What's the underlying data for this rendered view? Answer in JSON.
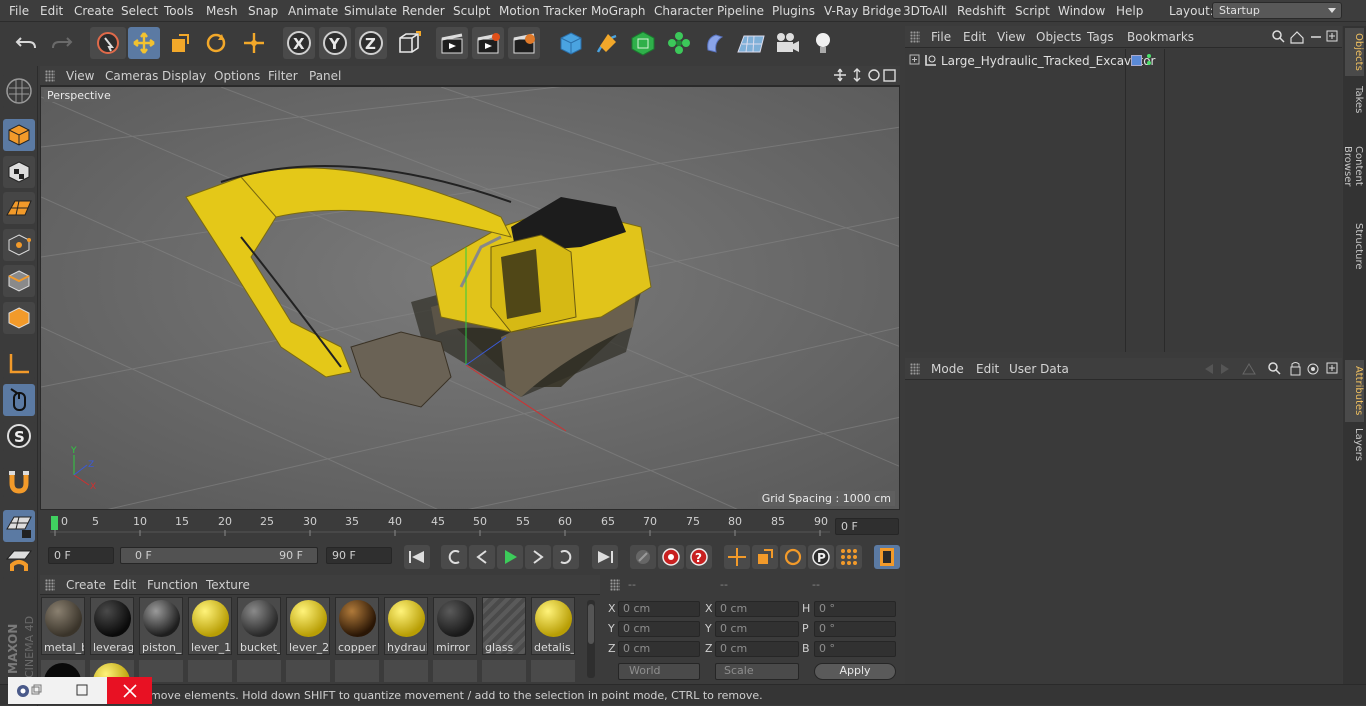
{
  "menu": [
    "File",
    "Edit",
    "Create",
    "Select",
    "Tools",
    "Mesh",
    "Snap",
    "Animate",
    "Simulate",
    "Render",
    "Sculpt",
    "Motion Tracker",
    "MoGraph",
    "Character",
    "Pipeline",
    "Plugins",
    "V-Ray Bridge",
    "3DToAll",
    "Redshift",
    "Script",
    "Window",
    "Help"
  ],
  "layout": {
    "label": "Layout:",
    "value": "Startup"
  },
  "viewport": {
    "menu": [
      "View",
      "Cameras",
      "Display",
      "Options",
      "Filter",
      "Panel"
    ],
    "label": "Perspective",
    "grid_spacing": "Grid Spacing : 1000 cm"
  },
  "timeline": {
    "ticks": [
      "0",
      "5",
      "10",
      "15",
      "20",
      "25",
      "30",
      "35",
      "40",
      "45",
      "50",
      "55",
      "60",
      "65",
      "70",
      "75",
      "80",
      "85",
      "90"
    ],
    "current_frame": "0 F"
  },
  "anim": {
    "start": "0 F",
    "range_start": "0 F",
    "range_end": "90 F",
    "end": "90 F"
  },
  "materials": {
    "menu": [
      "Create",
      "Edit",
      "Function",
      "Texture"
    ],
    "items": [
      {
        "name": "metal_b",
        "color": "#5a5248"
      },
      {
        "name": "leverage",
        "color": "#1a1a1a"
      },
      {
        "name": "piston_r",
        "color": "#3a3a3a"
      },
      {
        "name": "lever_1",
        "color": "#e0c81a"
      },
      {
        "name": "bucket_",
        "color": "#4a4a4a"
      },
      {
        "name": "lever_2",
        "color": "#e0c81a"
      },
      {
        "name": "copper",
        "color": "#5a3410"
      },
      {
        "name": "hydrauli",
        "color": "#e0c81a"
      },
      {
        "name": "mirror",
        "color": "#2a2a2a"
      },
      {
        "name": "glass",
        "color": "#6a6a6a"
      },
      {
        "name": "detalis_",
        "color": "#e0c81a"
      }
    ]
  },
  "coords": {
    "headers": [
      "--",
      "--",
      "--"
    ],
    "rows": [
      {
        "label": "X",
        "value": "0 cm",
        "label2": "X",
        "value2": "0 cm",
        "label3": "H",
        "value3": "0 °"
      },
      {
        "label": "Y",
        "value": "0 cm",
        "label2": "Y",
        "value2": "0 cm",
        "label3": "P",
        "value3": "0 °"
      },
      {
        "label": "Z",
        "value": "0 cm",
        "label2": "Z",
        "value2": "0 cm",
        "label3": "B",
        "value3": "0 °"
      }
    ],
    "world": "World",
    "scale": "Scale",
    "apply": "Apply"
  },
  "objects": {
    "menu": [
      "File",
      "Edit",
      "View",
      "Objects",
      "Tags",
      "Bookmarks"
    ],
    "items": [
      {
        "name": "Large_Hydraulic_Tracked_Excavator"
      }
    ]
  },
  "attributes": {
    "menu": [
      "Mode",
      "Edit",
      "User Data"
    ]
  },
  "right_tabs": [
    "Objects",
    "Takes",
    "Content Browser",
    "Structure"
  ],
  "right_tabs2": [
    "Attributes",
    "Layers"
  ],
  "status": "move elements. Hold down SHIFT to quantize movement / add to the selection in point mode, CTRL to remove.",
  "brand": {
    "maxon": "MAXON",
    "cinema": "CINEMA 4D"
  },
  "accent": "#5b7aa3"
}
